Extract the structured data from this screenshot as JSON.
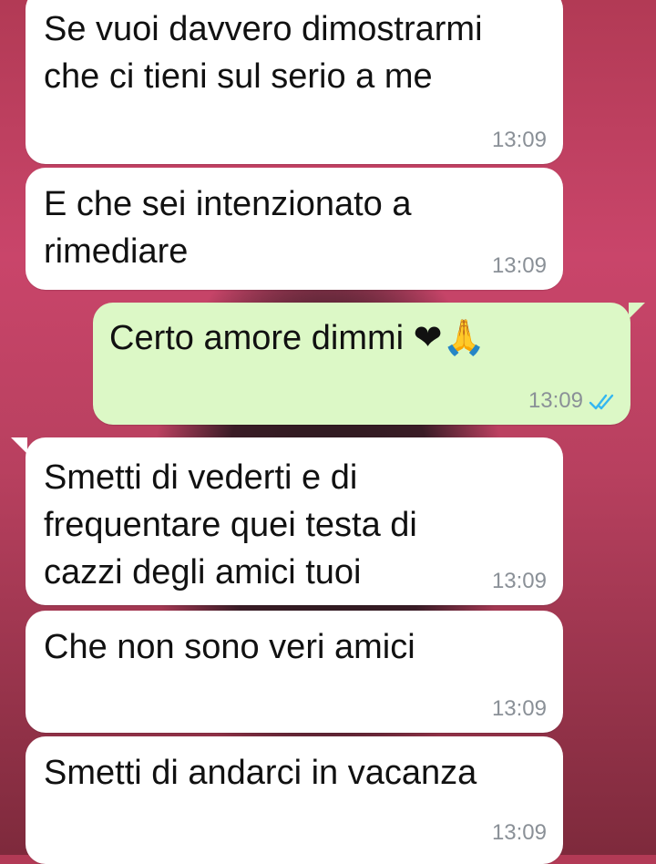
{
  "messages": [
    {
      "id": "m1",
      "direction": "incoming",
      "text": "Se vuoi davvero dimostrarmi\nche ci tieni sul serio a me",
      "time": "13:09"
    },
    {
      "id": "m2",
      "direction": "incoming",
      "text": "E che sei intenzionato a\nrimediare",
      "time": "13:09"
    },
    {
      "id": "m3",
      "direction": "outgoing",
      "text": "Certo amore dimmi",
      "emoji": [
        "red-heart",
        "folded-hands-light-skin"
      ],
      "emoji_glyphs": "❤🙏",
      "time": "13:09",
      "status": "read",
      "status_color": "#34b7f1"
    },
    {
      "id": "m4",
      "direction": "incoming",
      "text": "Smetti di vederti e di\nfrequentare quei testa di\ncazzi degli amici tuoi",
      "time": "13:09"
    },
    {
      "id": "m5",
      "direction": "incoming",
      "text": "Che non sono veri amici",
      "time": "13:09"
    },
    {
      "id": "m6",
      "direction": "incoming",
      "text": "Smetti di andarci in vacanza",
      "time": "13:09"
    }
  ],
  "colors": {
    "incoming_bubble": "#ffffff",
    "outgoing_bubble": "#dcf8c6",
    "timestamp": "#8a9097",
    "read_ticks": "#34b7f1"
  }
}
